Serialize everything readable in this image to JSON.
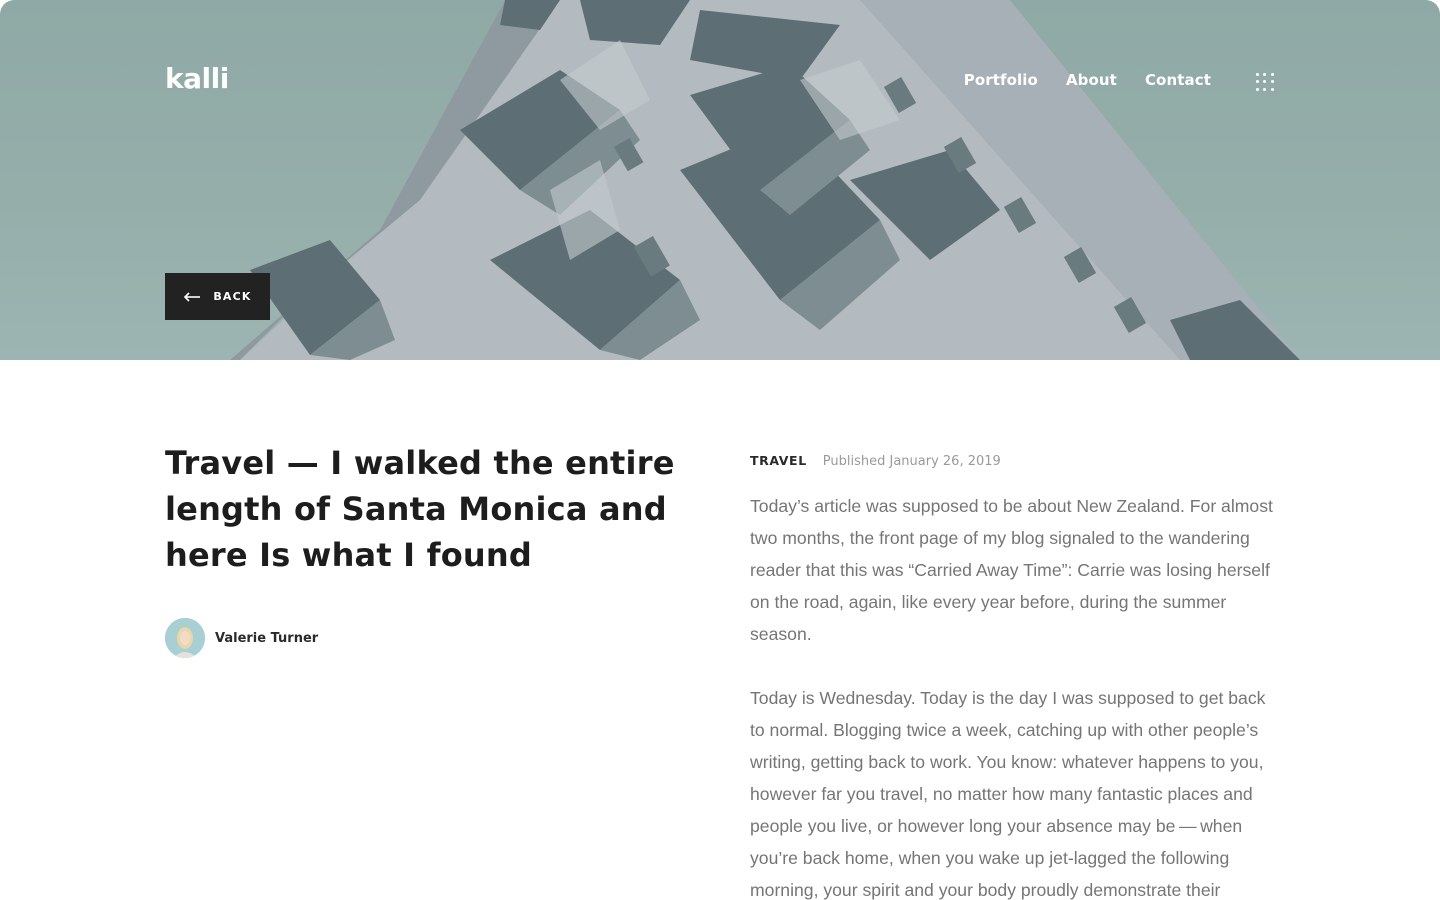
{
  "header": {
    "logo": "kalli",
    "nav": [
      {
        "label": "Portfolio"
      },
      {
        "label": "About"
      },
      {
        "label": "Contact"
      }
    ],
    "menu_icon": "grid-menu-icon"
  },
  "hero": {
    "back_label": "BACK",
    "back_icon": "arrow-left-icon",
    "background_color": "#94ada9"
  },
  "article": {
    "title": "Travel — I walked the entire length of Santa Monica and here Is what I found",
    "author": {
      "name": "Valerie Turner"
    },
    "category": "TRAVEL",
    "published": "Published January 26, 2019",
    "paragraphs": [
      "Today’s article was supposed to be about New Zealand. For almost two months, the front page of my blog signaled to the wandering reader that this was “Carried Away Time”: Carrie was losing herself on the road, again, like every year before, during the summer season.",
      "Today is Wednesday. Today is the day I was supposed to get back to normal. Blogging twice a week, catching up with other people’s writing, getting back to work. You know: whatever happens to you, however far you travel, no matter how many fantastic places and people you live, or however long your absence may be — when you’re back home, when you wake up jet-lagged the following morning, your spirit and your body proudly demonstrate their"
    ]
  },
  "colors": {
    "text_dark": "#1d1d1d",
    "text_body": "#757575",
    "text_muted": "#9a9a9a",
    "button_bg": "#222222"
  }
}
